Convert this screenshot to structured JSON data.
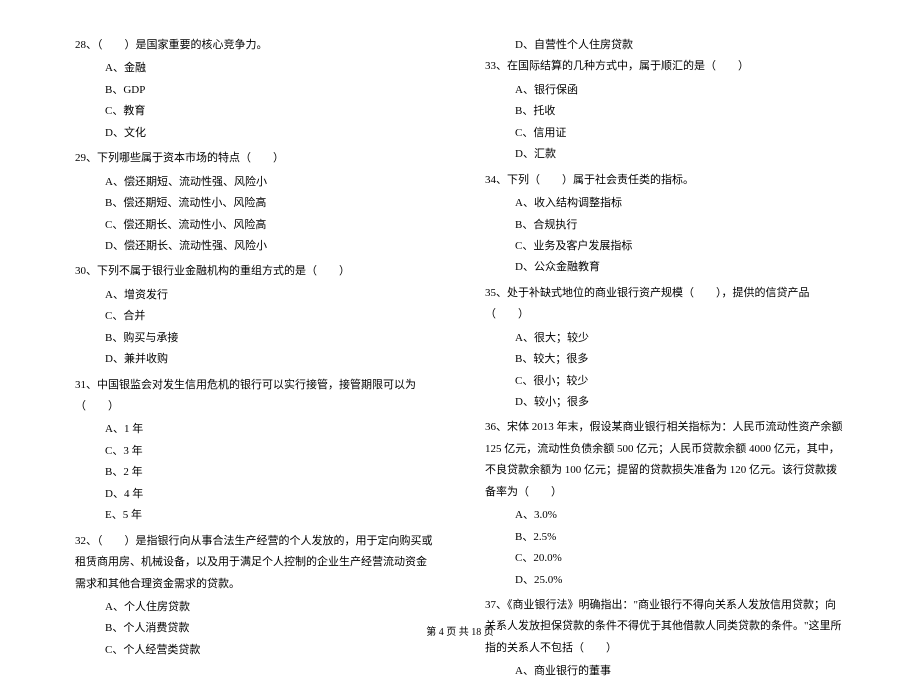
{
  "left": {
    "q28": {
      "text": "28、（　　）是国家重要的核心竞争力。",
      "a": "A、金融",
      "b": "B、GDP",
      "c": "C、教育",
      "d": "D、文化"
    },
    "q29": {
      "text": "29、下列哪些属于资本市场的特点（　　）",
      "a": "A、偿还期短、流动性强、风险小",
      "b": "B、偿还期短、流动性小、风险高",
      "c": "C、偿还期长、流动性小、风险高",
      "d": "D、偿还期长、流动性强、风险小"
    },
    "q30": {
      "text": "30、下列不属于银行业金融机构的重组方式的是（　　）",
      "a": "A、增资发行",
      "c": "C、合并",
      "b": "B、购买与承接",
      "d": "D、兼并收购"
    },
    "q31": {
      "text": "31、中国银监会对发生信用危机的银行可以实行接管，接管期限可以为（　　）",
      "a": "A、1 年",
      "c": "C、3 年",
      "b": "B、2 年",
      "d": "D、4 年",
      "e": "E、5 年"
    },
    "q32": {
      "text": "32、（　　）是指银行向从事合法生产经营的个人发放的，用于定向购买或租赁商用房、机械设备，以及用于满足个人控制的企业生产经营流动资金需求和其他合理资金需求的贷款。",
      "a": "A、个人住房贷款",
      "b": "B、个人消费贷款",
      "c": "C、个人经营类贷款"
    }
  },
  "right": {
    "q32d": "D、自营性个人住房贷款",
    "q33": {
      "text": "33、在国际结算的几种方式中，属于顺汇的是（　　）",
      "a": "A、银行保函",
      "b": "B、托收",
      "c": "C、信用证",
      "d": "D、汇款"
    },
    "q34": {
      "text": "34、下列（　　）属于社会责任类的指标。",
      "a": "A、收入结构调整指标",
      "b": "B、合规执行",
      "c": "C、业务及客户发展指标",
      "d": "D、公众金融教育"
    },
    "q35": {
      "text": "35、处于补缺式地位的商业银行资产规模（　　），提供的信贷产品（　　）",
      "a": "A、很大；较少",
      "b": "B、较大；很多",
      "c": "C、很小；较少",
      "d": "D、较小；很多"
    },
    "q36": {
      "text": "36、宋体 2013 年末，假设某商业银行相关指标为：人民币流动性资产余额 125 亿元，流动性负债余额 500 亿元；人民币贷款余额 4000 亿元，其中，不良贷款余额为 100 亿元；提留的贷款损失准备为 120 亿元。该行贷款拨备率为（　　）",
      "a": "A、3.0%",
      "b": "B、2.5%",
      "c": "C、20.0%",
      "d": "D、25.0%"
    },
    "q37": {
      "text": "37、《商业银行法》明确指出：\"商业银行不得向关系人发放信用贷款；向关系人发放担保贷款的条件不得优于其他借款人同类贷款的条件。\"这里所指的关系人不包括（　　）",
      "a": "A、商业银行的董事"
    }
  },
  "footer": "第 4 页  共 18 页"
}
